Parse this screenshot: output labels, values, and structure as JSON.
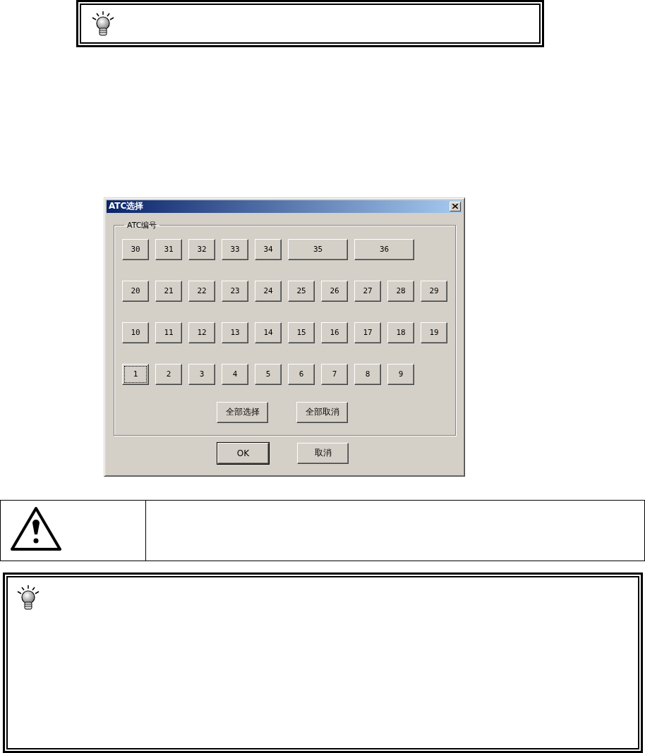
{
  "dialog": {
    "title": "ATC选择",
    "group": {
      "label": "ATC编号",
      "rows": [
        [
          {
            "label": "30",
            "wide": false,
            "focused": false
          },
          {
            "label": "31",
            "wide": false,
            "focused": false
          },
          {
            "label": "32",
            "wide": false,
            "focused": false
          },
          {
            "label": "33",
            "wide": false,
            "focused": false
          },
          {
            "label": "34",
            "wide": false,
            "focused": false
          },
          {
            "label": "35",
            "wide": true,
            "focused": false
          },
          {
            "label": "36",
            "wide": true,
            "focused": false
          }
        ],
        [
          {
            "label": "20",
            "wide": false,
            "focused": false
          },
          {
            "label": "21",
            "wide": false,
            "focused": false
          },
          {
            "label": "22",
            "wide": false,
            "focused": false
          },
          {
            "label": "23",
            "wide": false,
            "focused": false
          },
          {
            "label": "24",
            "wide": false,
            "focused": false
          },
          {
            "label": "25",
            "wide": false,
            "focused": false
          },
          {
            "label": "26",
            "wide": false,
            "focused": false
          },
          {
            "label": "27",
            "wide": false,
            "focused": false
          },
          {
            "label": "28",
            "wide": false,
            "focused": false
          },
          {
            "label": "29",
            "wide": false,
            "focused": false
          }
        ],
        [
          {
            "label": "10",
            "wide": false,
            "focused": false
          },
          {
            "label": "11",
            "wide": false,
            "focused": false
          },
          {
            "label": "12",
            "wide": false,
            "focused": false
          },
          {
            "label": "13",
            "wide": false,
            "focused": false
          },
          {
            "label": "14",
            "wide": false,
            "focused": false
          },
          {
            "label": "15",
            "wide": false,
            "focused": false
          },
          {
            "label": "16",
            "wide": false,
            "focused": false
          },
          {
            "label": "17",
            "wide": false,
            "focused": false
          },
          {
            "label": "18",
            "wide": false,
            "focused": false
          },
          {
            "label": "19",
            "wide": false,
            "focused": false
          }
        ],
        [
          {
            "label": "1",
            "wide": false,
            "focused": true
          },
          {
            "label": "2",
            "wide": false,
            "focused": false
          },
          {
            "label": "3",
            "wide": false,
            "focused": false
          },
          {
            "label": "4",
            "wide": false,
            "focused": false
          },
          {
            "label": "5",
            "wide": false,
            "focused": false
          },
          {
            "label": "6",
            "wide": false,
            "focused": false
          },
          {
            "label": "7",
            "wide": false,
            "focused": false
          },
          {
            "label": "8",
            "wide": false,
            "focused": false
          },
          {
            "label": "9",
            "wide": false,
            "focused": false
          }
        ]
      ],
      "actions": [
        {
          "label": "全部选择",
          "default": false
        },
        {
          "label": "全部取消",
          "default": false
        }
      ]
    },
    "buttons": [
      {
        "label": "OK",
        "default": true
      },
      {
        "label": "取消",
        "default": false
      }
    ]
  }
}
